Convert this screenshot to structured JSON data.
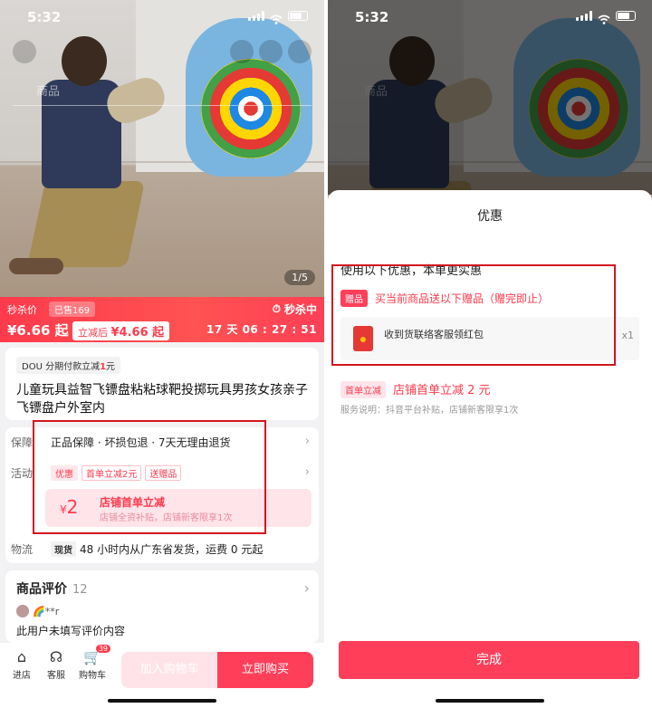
{
  "status": {
    "time": "5:32"
  },
  "left": {
    "photo": {
      "tab_label": "商品",
      "counter": "1/5"
    },
    "price": {
      "label": "秒杀价",
      "sold": "已售169",
      "price": "¥6.66 起",
      "discount_prefix": "立减后",
      "discount_price": "¥4.66 起",
      "flash_label": "秒杀中",
      "countdown": "17 天 06 : 27 : 51"
    },
    "installment": {
      "text": "DOU 分期付款立减",
      "amount": "1",
      "suffix": "元"
    },
    "product_title": "儿童玩具益智飞镖盘粘粘球靶投掷玩具男孩女孩亲子飞镖盘户外室内",
    "guarantee": {
      "key": "保障",
      "value": "正品保障 · 坏损包退 · 7天无理由退货"
    },
    "activity": {
      "key": "活动",
      "tags": [
        "优惠",
        "首单立减2元",
        "送赠品"
      ]
    },
    "coupon": {
      "currency": "¥",
      "amount": "2",
      "title": "店铺首单立减",
      "subtitle": "店铺全资补贴，店铺新客限享1次"
    },
    "logistics": {
      "key": "物流",
      "tag": "现货",
      "value": "48 小时内从广东省发货，运费 0 元起"
    },
    "reviews": {
      "title": "商品评价",
      "count": "12",
      "user": "🌈**r",
      "text": "此用户未填写评价内容"
    },
    "bottom": {
      "store": "进店",
      "service": "客服",
      "cart": "购物车",
      "cart_count": "39",
      "add_to_cart": "加入购物车",
      "buy_now": "立即购买"
    }
  },
  "right": {
    "sheet_title": "优惠",
    "subtitle": "使用以下优惠，本单更实惠",
    "gift": {
      "tag": "赠品",
      "text": "买当前商品送以下赠品（赠完即止）",
      "item_name": "收到货联络客服领红包",
      "item_qty": "x1"
    },
    "first_order": {
      "tag": "首单立减",
      "text": "店铺首单立减 2 元"
    },
    "service_note": "服务说明：抖音平台补贴，店铺新客限享1次",
    "done": "完成"
  }
}
